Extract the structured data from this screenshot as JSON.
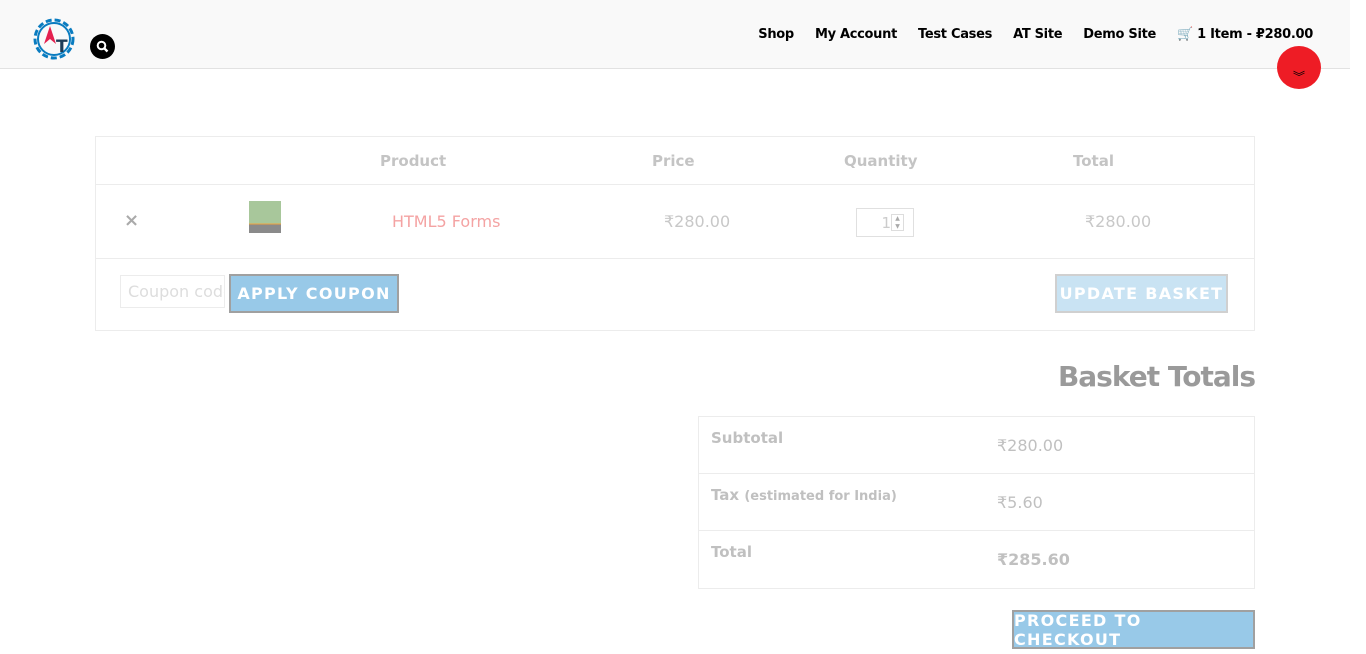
{
  "nav": {
    "items": [
      "Shop",
      "My Account",
      "Test Cases",
      "AT Site",
      "Demo Site"
    ],
    "cart": "1 Item - ₽280.00"
  },
  "cart": {
    "headers": {
      "product": "Product",
      "price": "Price",
      "quantity": "Quantity",
      "total": "Total"
    },
    "item": {
      "remove": "×",
      "name": "HTML5 Forms",
      "price": "₹280.00",
      "quantity": "1",
      "total": "₹280.00"
    },
    "coupon_placeholder": "Coupon code",
    "apply_coupon": "APPLY COUPON",
    "update_basket": "UPDATE BASKET"
  },
  "totals": {
    "title": "Basket Totals",
    "subtotal_label": "Subtotal",
    "subtotal": "₹280.00",
    "tax_label": "Tax",
    "tax_note": "(estimated for India)",
    "tax": "₹5.60",
    "total_label": "Total",
    "total": "₹285.60",
    "checkout": "PROCEED TO CHECKOUT"
  },
  "colors": {
    "accent": "#98c9e8",
    "link": "#f4a3a3",
    "scroll": "#ee1c25"
  }
}
